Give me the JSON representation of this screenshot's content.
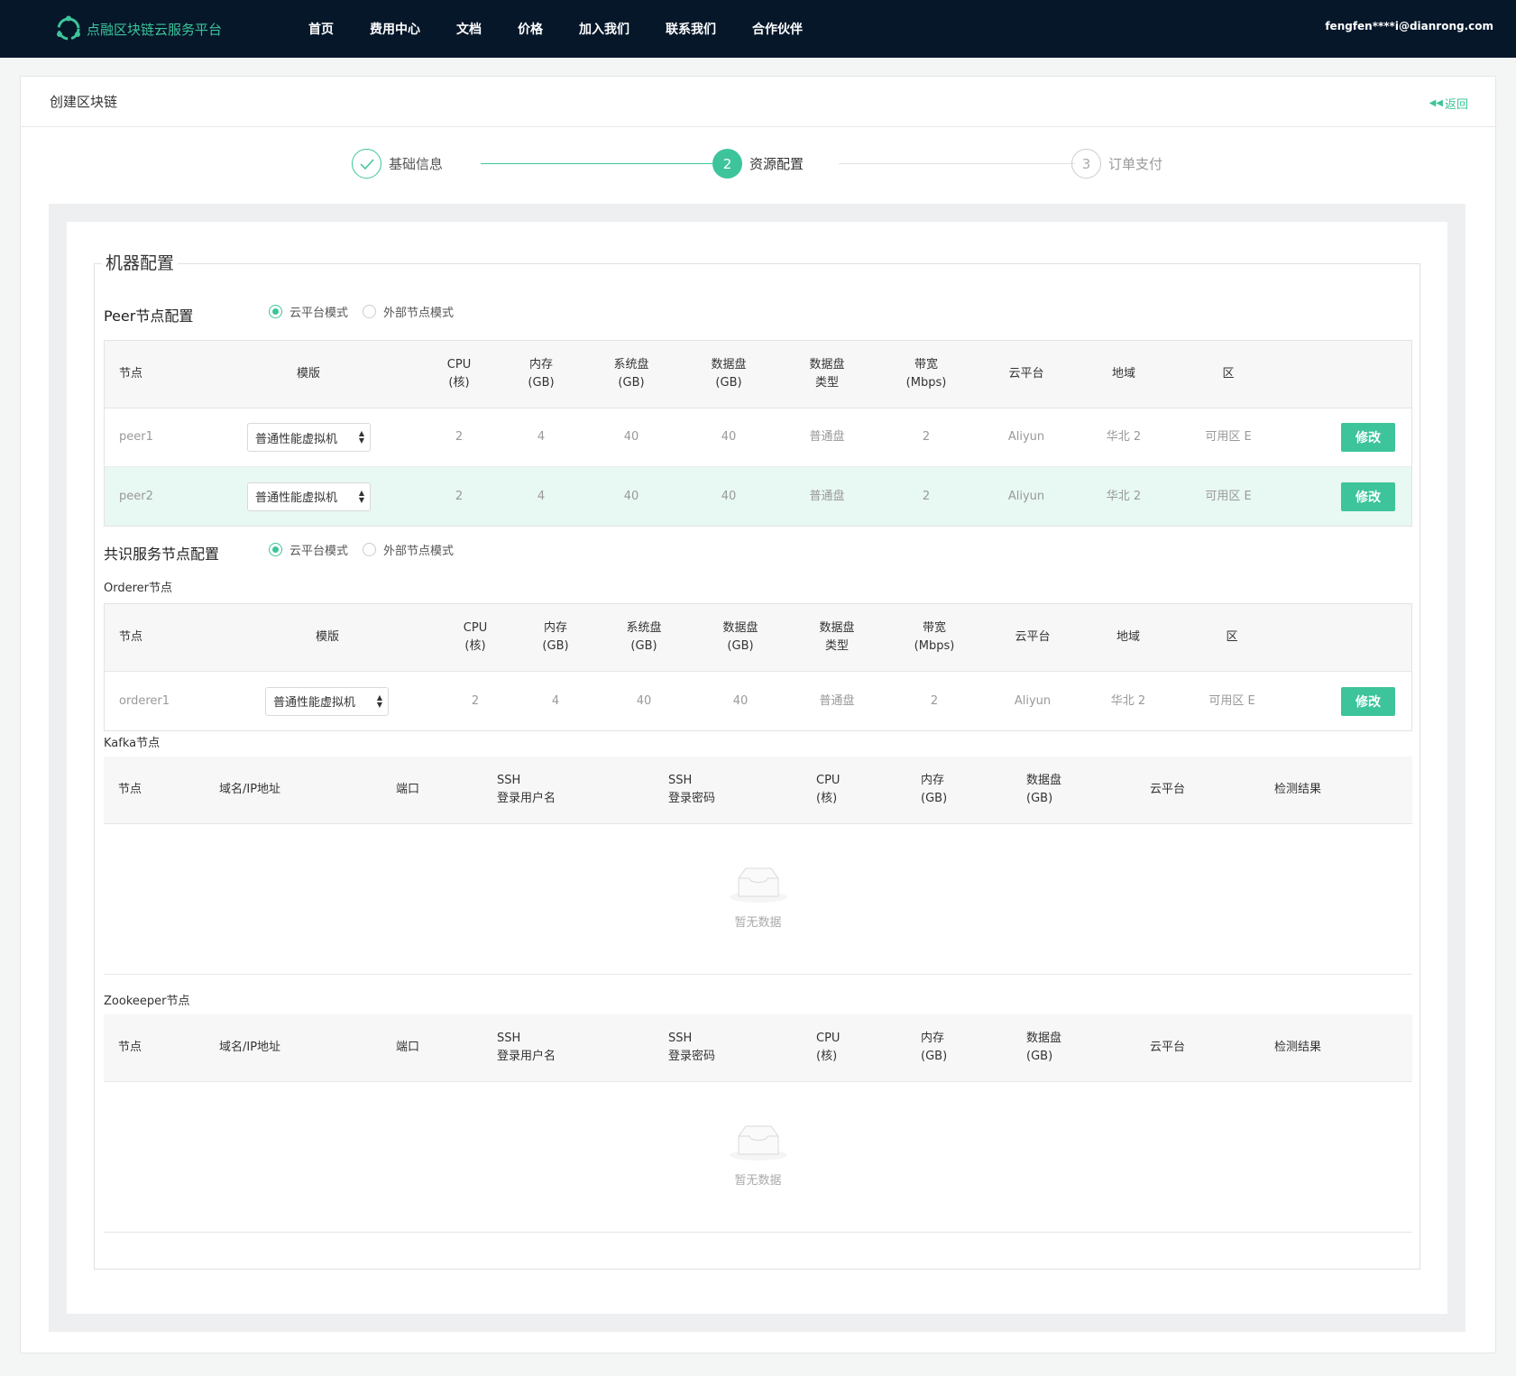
{
  "brand": {
    "name": "点融区块链云服务平台"
  },
  "nav": [
    "首页",
    "费用中心",
    "文档",
    "价格",
    "加入我们",
    "联系我们",
    "合作伙伴"
  ],
  "user": "fengfen****i@dianrong.com",
  "page": {
    "title": "创建区块链",
    "back": "返回"
  },
  "steps": [
    {
      "num": "✓",
      "label": "基础信息"
    },
    {
      "num": "2",
      "label": "资源配置"
    },
    {
      "num": "3",
      "label": "订单支付"
    }
  ],
  "machine_config": {
    "legend": "机器配置"
  },
  "mode_options": {
    "cloud": "云平台模式",
    "external": "外部节点模式"
  },
  "peer": {
    "title": "Peer节点配置",
    "headers": [
      "节点",
      "模版",
      "CPU\n(核)",
      "内存\n(GB)",
      "系统盘\n(GB)",
      "数据盘\n(GB)",
      "数据盘\n类型",
      "带宽\n(Mbps)",
      "云平台",
      "地域",
      "区"
    ],
    "rows": [
      {
        "node": "peer1",
        "template": "普通性能虚拟机",
        "cpu": "2",
        "mem": "4",
        "sys_disk": "40",
        "data_disk": "40",
        "disk_type": "普通盘",
        "bandwidth": "2",
        "cloud": "Aliyun",
        "region": "华北 2",
        "zone": "可用区 E",
        "action": "修改"
      },
      {
        "node": "peer2",
        "template": "普通性能虚拟机",
        "cpu": "2",
        "mem": "4",
        "sys_disk": "40",
        "data_disk": "40",
        "disk_type": "普通盘",
        "bandwidth": "2",
        "cloud": "Aliyun",
        "region": "华北 2",
        "zone": "可用区 E",
        "action": "修改"
      }
    ]
  },
  "consensus": {
    "title": "共识服务节点配置"
  },
  "orderer": {
    "title": "Orderer节点",
    "headers": [
      "节点",
      "模版",
      "CPU\n(核)",
      "内存\n(GB)",
      "系统盘\n(GB)",
      "数据盘\n(GB)",
      "数据盘\n类型",
      "带宽\n(Mbps)",
      "云平台",
      "地域",
      "区"
    ],
    "rows": [
      {
        "node": "orderer1",
        "template": "普通性能虚拟机",
        "cpu": "2",
        "mem": "4",
        "sys_disk": "40",
        "data_disk": "40",
        "disk_type": "普通盘",
        "bandwidth": "2",
        "cloud": "Aliyun",
        "region": "华北 2",
        "zone": "可用区 E",
        "action": "修改"
      }
    ]
  },
  "kafka": {
    "title": "Kafka节点",
    "headers": [
      "节点",
      "域名/IP地址",
      "端口",
      "SSH\n登录用户名",
      "SSH\n登录密码",
      "CPU\n(核)",
      "内存\n(GB)",
      "数据盘\n(GB)",
      "云平台",
      "检测结果"
    ],
    "empty": "暂无数据"
  },
  "zookeeper": {
    "title": "Zookeeper节点",
    "headers": [
      "节点",
      "域名/IP地址",
      "端口",
      "SSH\n登录用户名",
      "SSH\n登录密码",
      "CPU\n(核)",
      "内存\n(GB)",
      "数据盘\n(GB)",
      "云平台",
      "检测结果"
    ],
    "empty": "暂无数据"
  },
  "colors": {
    "accent": "#3dc49a",
    "topbar": "#06172a",
    "row_highlight": "#e8f8f2"
  },
  "icons": {
    "logo": "logo-icon",
    "back": "double-left-arrow-icon",
    "check": "check-icon",
    "select": "select-arrows-icon",
    "empty": "empty-inbox-icon"
  }
}
